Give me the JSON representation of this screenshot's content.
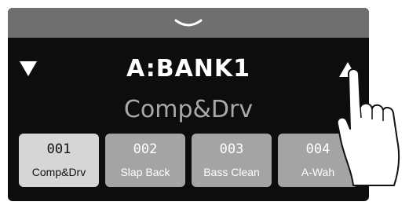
{
  "header": {
    "pull_down_icon": "chevron-down-icon"
  },
  "nav": {
    "prev_icon": "triangle-down-icon",
    "next_icon": "triangle-up-icon"
  },
  "bank": {
    "title": "A:BANK1"
  },
  "current_patch": {
    "name": "Comp&Drv"
  },
  "patches": [
    {
      "number": "001",
      "name": "Comp&Drv",
      "selected": true
    },
    {
      "number": "002",
      "name": "Slap Back",
      "selected": false
    },
    {
      "number": "003",
      "name": "Bass Clean",
      "selected": false
    },
    {
      "number": "004",
      "name": "A-Wah",
      "selected": false
    }
  ],
  "colors": {
    "screen_bg": "#0d0d0d",
    "pull_tab": "#6f6f6f",
    "patch_button": "#a4a4a4",
    "patch_selected": "#d6d6d6",
    "patch_name": "#a9a9a9"
  }
}
